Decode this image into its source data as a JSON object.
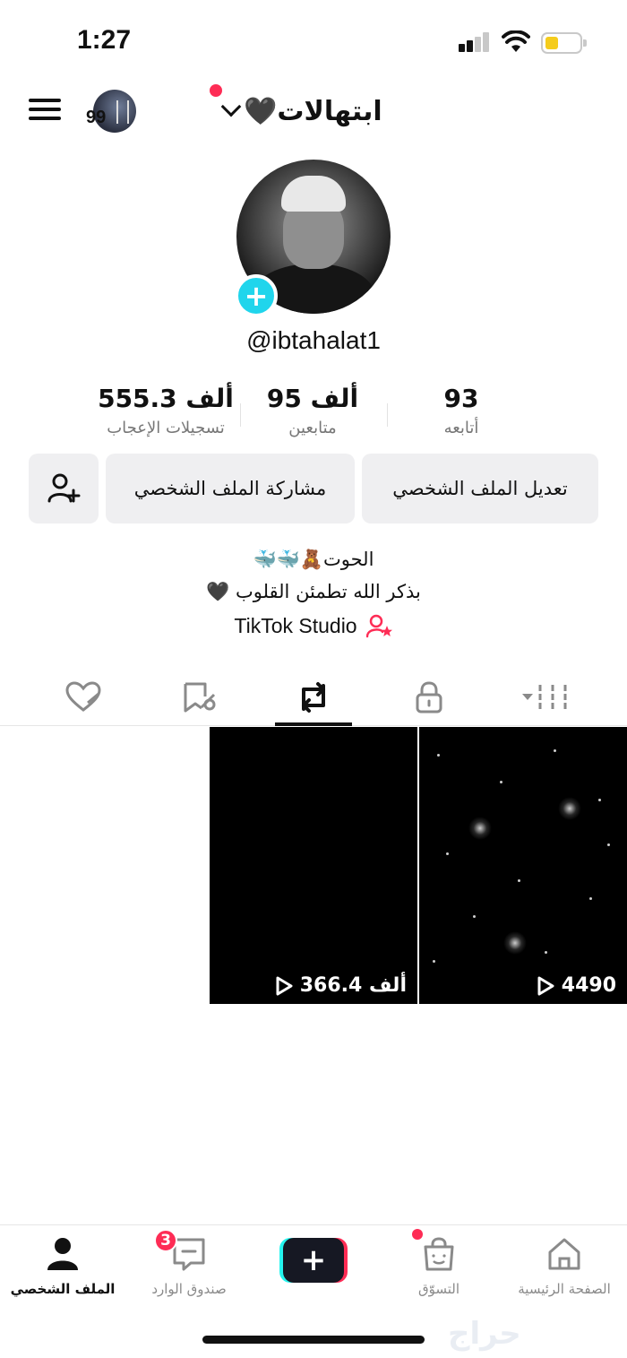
{
  "status": {
    "time": "1:27"
  },
  "header": {
    "username": "ابتهالات🖤",
    "avatar_badge": "99"
  },
  "profile": {
    "handle": "@ibtahalat1",
    "add_symbol": "+"
  },
  "stats": [
    {
      "value": "555.3 ألف",
      "label": "تسجيلات الإعجاب"
    },
    {
      "value": "95 ألف",
      "label": "متابعين"
    },
    {
      "value": "93",
      "label": "أتابعه"
    }
  ],
  "actions": {
    "edit_profile": "تعديل الملف الشخصي",
    "share_profile": "مشاركة الملف الشخصي"
  },
  "bio": {
    "line1": "الحوت🧸🐳🐳",
    "line2": "بذكر الله تطمئن القلوب 🖤"
  },
  "studio": {
    "label": "TikTok Studio"
  },
  "videos": [
    {
      "views": "4490"
    },
    {
      "views": "366.4 ألف"
    }
  ],
  "bottom_nav": {
    "home": "الصفحة الرئيسية",
    "shop": "التسوّق",
    "create": "+",
    "inbox": "صندوق الوارد",
    "inbox_badge": "3",
    "profile": "الملف الشخصي"
  },
  "watermark": "حراج",
  "colors": {
    "accent_pink": "#fe2c55",
    "accent_cyan": "#25f4ee",
    "avatar_add": "#20d5ec",
    "button_bg": "#efeff1"
  },
  "icons": [
    "signal-icon",
    "wifi-icon",
    "battery-icon",
    "menu-icon",
    "chevron-down-icon",
    "add-friend-icon",
    "studio-icon",
    "liked-icon",
    "favorites-icon",
    "repost-icon",
    "lock-icon",
    "grid-icon",
    "play-icon",
    "home-icon",
    "shop-icon",
    "inbox-icon",
    "profile-icon"
  ]
}
